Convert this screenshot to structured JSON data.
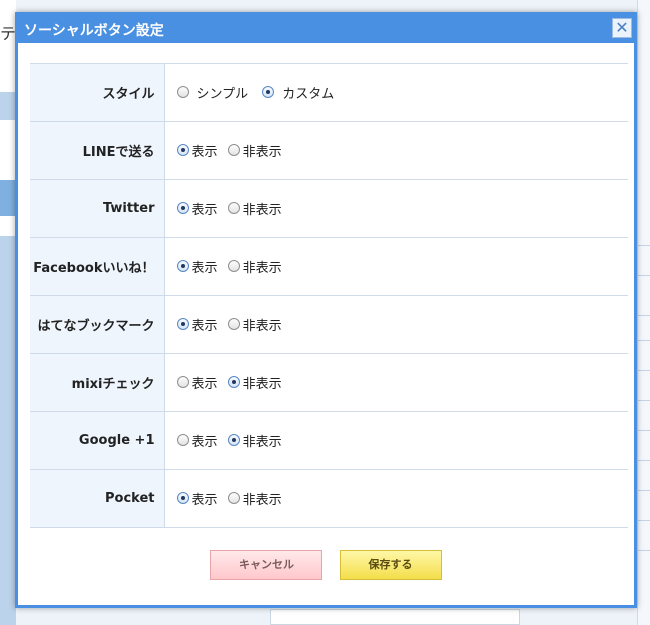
{
  "background": {
    "top_char": "テ"
  },
  "dialog": {
    "title": "ソーシャルボタン設定",
    "close_symbol": "✕",
    "style_row": {
      "label": "スタイル",
      "options": [
        "シンプル",
        "カスタム"
      ],
      "selected": "カスタム"
    },
    "rows": [
      {
        "label": "LINEで送る",
        "show": "表示",
        "hide": "非表示",
        "selected": "show"
      },
      {
        "label": "Twitter",
        "show": "表示",
        "hide": "非表示",
        "selected": "show"
      },
      {
        "label": "Facebookいいね！",
        "show": "表示",
        "hide": "非表示",
        "selected": "show"
      },
      {
        "label": "はてなブックマーク",
        "show": "表示",
        "hide": "非表示",
        "selected": "show"
      },
      {
        "label": "mixiチェック",
        "show": "表示",
        "hide": "非表示",
        "selected": "hide"
      },
      {
        "label": "Google +1",
        "show": "表示",
        "hide": "非表示",
        "selected": "hide"
      },
      {
        "label": "Pocket",
        "show": "表示",
        "hide": "非表示",
        "selected": "show"
      }
    ],
    "buttons": {
      "cancel": "キャンセル",
      "save": "保存する"
    }
  },
  "colors": {
    "accent": "#4a90e2",
    "label_bg": "#eef5fd",
    "cancel_bg": "#ffc8cc",
    "save_bg": "#f4de4a"
  }
}
